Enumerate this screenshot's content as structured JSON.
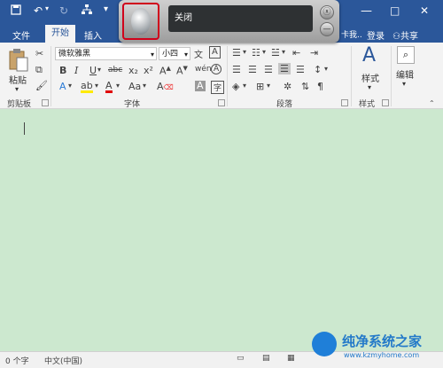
{
  "quick_access": {
    "save_icon": "save-icon",
    "undo_icon": "undo-icon",
    "redo_icon": "redo-icon",
    "tree_icon": "tree-icon",
    "dropdown_icon": "dropdown-icon"
  },
  "window_controls": {
    "restore": "□",
    "close": "✕"
  },
  "tabs": {
    "file": "文件",
    "home": "开始",
    "insert": "插入",
    "truncated": "卡我..",
    "login": "登录",
    "share": "共享"
  },
  "speech": {
    "status": "关闭",
    "close_symbol": "ⓧ",
    "min_symbol": "—"
  },
  "clipboard": {
    "paste_label": "粘贴",
    "group_label": "剪贴板"
  },
  "font": {
    "font_name": "微软雅黑",
    "font_size": "小四",
    "group_label": "字体",
    "bold": "B",
    "italic": "I",
    "underline": "U",
    "strike": "abc",
    "sub": "x₂",
    "sup": "x²",
    "case": "Aa",
    "grow": "A",
    "clear": "A"
  },
  "paragraph": {
    "group_label": "段落"
  },
  "styles": {
    "label": "样式",
    "group_label": "样式"
  },
  "editing": {
    "label": "编辑"
  },
  "status": {
    "word_count": "0 个字",
    "language": "中文(中国)"
  },
  "watermark": {
    "title": "纯净系统之家",
    "url": "www.kzmyhome.com"
  },
  "colors": {
    "accent": "#2b579a",
    "doc_bg": "#cce8cf",
    "highlight": "#d0021b"
  }
}
